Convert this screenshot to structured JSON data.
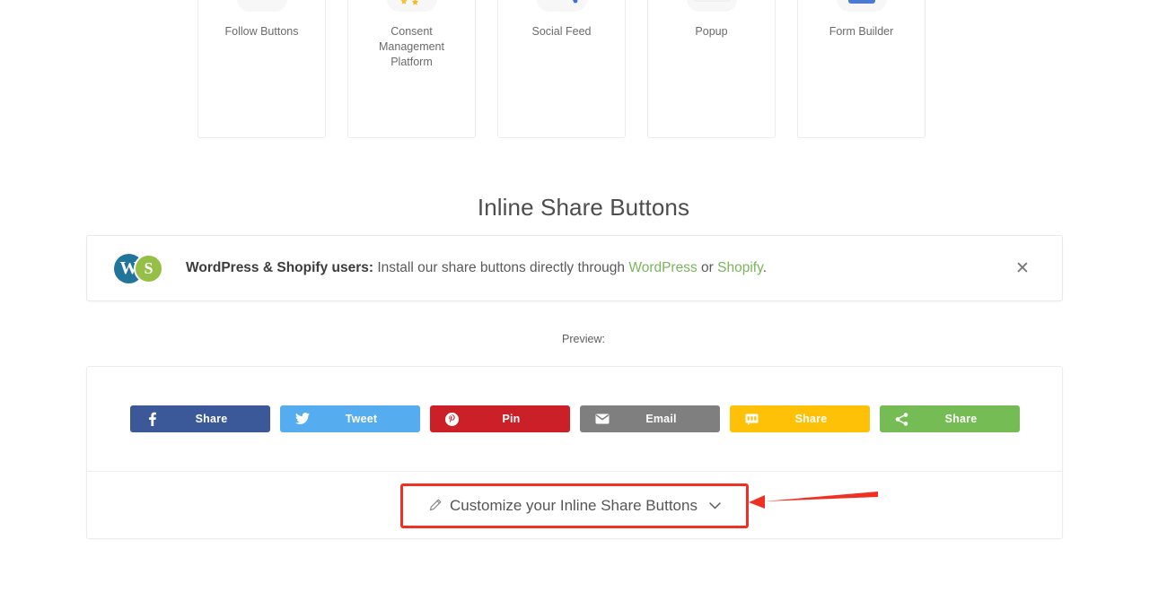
{
  "products": [
    {
      "label": "Follow Buttons",
      "icon": "follow-buttons-icon"
    },
    {
      "label": "Consent Management Platform",
      "icon": "consent-management-icon"
    },
    {
      "label": "Social Feed",
      "icon": "social-feed-icon"
    },
    {
      "label": "Popup",
      "icon": "popup-icon"
    },
    {
      "label": "Form Builder",
      "icon": "form-builder-icon"
    }
  ],
  "section": {
    "title": "Inline Share Buttons"
  },
  "notice": {
    "bold_prefix": "WordPress & Shopify users:",
    "text_1": " Install our share buttons directly through ",
    "link_wordpress": "WordPress",
    "text_2": " or ",
    "link_shopify": "Shopify",
    "text_3": ".",
    "close_icon": "✕",
    "link_color": "#7ab55c",
    "wordpress_logo_glyph": "W",
    "shopify_logo_glyph": "S"
  },
  "preview": {
    "label": "Preview:",
    "buttons": [
      {
        "network": "facebook",
        "label": "Share",
        "icon": "facebook-icon",
        "color": "#3b5998"
      },
      {
        "network": "twitter",
        "label": "Tweet",
        "icon": "twitter-icon",
        "color": "#55acee"
      },
      {
        "network": "pinterest",
        "label": "Pin",
        "icon": "pinterest-icon",
        "color": "#cb2027"
      },
      {
        "network": "email",
        "label": "Email",
        "icon": "email-icon",
        "color": "#7f7f7f"
      },
      {
        "network": "sms",
        "label": "Share",
        "icon": "sms-icon",
        "color": "#ffc107"
      },
      {
        "network": "sharethis",
        "label": "Share",
        "icon": "share-icon",
        "color": "#75bc54"
      }
    ]
  },
  "customize": {
    "label": "Customize your Inline Share Buttons",
    "pencil_icon": "pencil-icon",
    "chevron_icon": "chevron-down-icon",
    "highlight_color": "#ef3124"
  },
  "annotation": {
    "arrow_color": "#ef3124",
    "arrow_direction": "left"
  }
}
